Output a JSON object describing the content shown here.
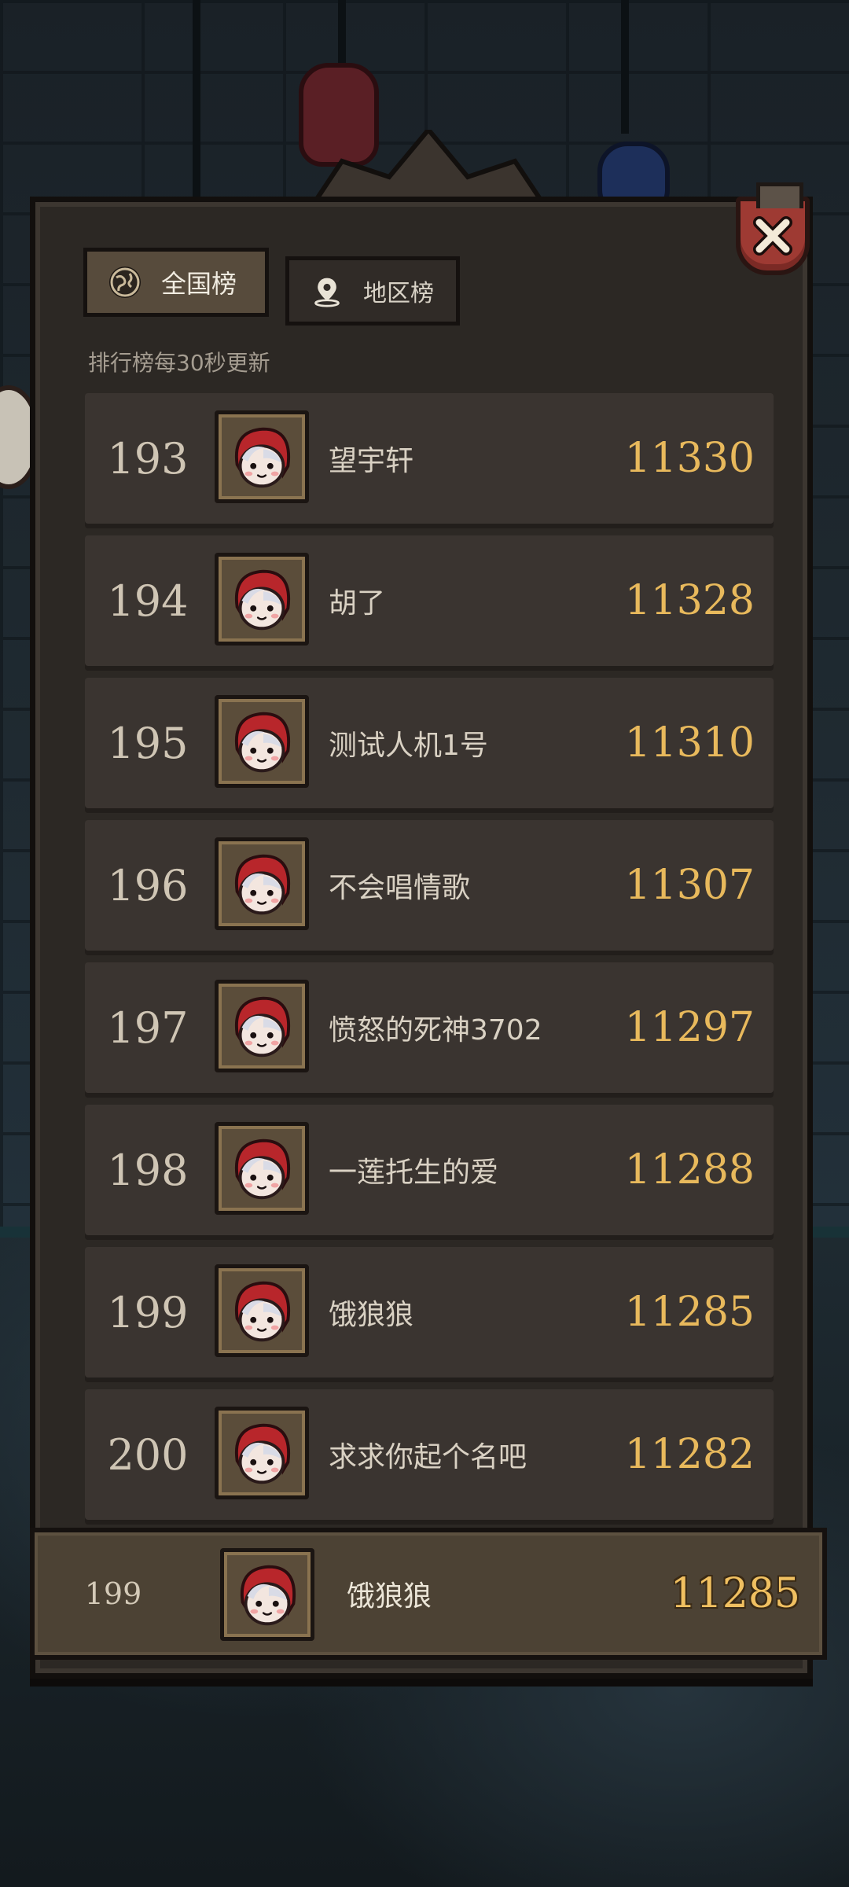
{
  "tabs": {
    "national": {
      "label": "全国榜",
      "selected": true,
      "icon": "globe-icon"
    },
    "region": {
      "label": "地区榜",
      "selected": false,
      "icon": "location-pin-icon"
    }
  },
  "update_note": "排行榜每30秒更新",
  "leaderboard": [
    {
      "rank": "193",
      "name": "望宇轩",
      "score": "11330"
    },
    {
      "rank": "194",
      "name": "胡了",
      "score": "11328"
    },
    {
      "rank": "195",
      "name": "测试人机1号",
      "score": "11310"
    },
    {
      "rank": "196",
      "name": "不会唱情歌",
      "score": "11307"
    },
    {
      "rank": "197",
      "name": "愤怒的死神3702",
      "score": "11297"
    },
    {
      "rank": "198",
      "name": "一莲托生的爱",
      "score": "11288"
    },
    {
      "rank": "199",
      "name": "饿狼狼",
      "score": "11285"
    },
    {
      "rank": "200",
      "name": "求求你起个名吧",
      "score": "11282"
    }
  ],
  "my_rank": {
    "rank": "199",
    "name": "饿狼狼",
    "score": "11285"
  },
  "colors": {
    "score": "#e8b95c",
    "panel": "#2c2824",
    "row": "#3a3430",
    "close": "#9e3a33"
  }
}
